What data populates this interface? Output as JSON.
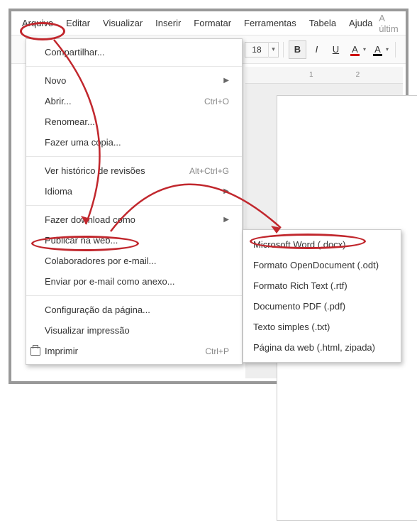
{
  "menubar": {
    "items": [
      "Arquivo",
      "Editar",
      "Visualizar",
      "Inserir",
      "Formatar",
      "Ferramentas",
      "Tabela",
      "Ajuda"
    ],
    "tail": "A últim"
  },
  "toolbar": {
    "fontSize": "18",
    "ruler": [
      "1",
      "2"
    ]
  },
  "menu1": {
    "share": "Compartilhar...",
    "novo": "Novo",
    "abrir": "Abrir...",
    "abrir_sc": "Ctrl+O",
    "renomear": "Renomear...",
    "copia": "Fazer uma cópia...",
    "revisoes": "Ver histórico de revisões",
    "revisoes_sc": "Alt+Ctrl+G",
    "idioma": "Idioma",
    "download": "Fazer download como",
    "publicar": "Publicar na web...",
    "colab": "Colaboradores por e-mail...",
    "anexo": "Enviar por e-mail como anexo...",
    "config": "Configuração da página...",
    "visimp": "Visualizar impressão",
    "imprimir": "Imprimir",
    "imprimir_sc": "Ctrl+P"
  },
  "menu2": {
    "docx": "Microsoft Word (.docx)",
    "odt": "Formato OpenDocument (.odt)",
    "rtf": "Formato Rich Text (.rtf)",
    "pdf": "Documento PDF (.pdf)",
    "txt": "Texto simples (.txt)",
    "html": "Página da web (.html, zipada)"
  }
}
